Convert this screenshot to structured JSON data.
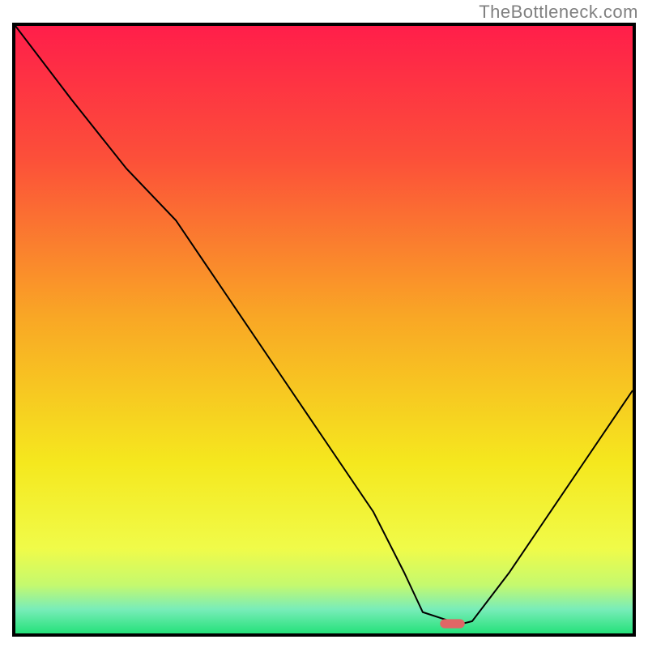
{
  "watermark_text": "TheBottleneck.com",
  "chart_data": {
    "type": "line",
    "title": "",
    "xlabel": "",
    "ylabel": "",
    "xlim": [
      0,
      100
    ],
    "ylim": [
      0,
      100
    ],
    "grid": false,
    "legend": false,
    "background_gradient": {
      "stops": [
        {
          "offset": 0.0,
          "color": "#ff1e4a"
        },
        {
          "offset": 0.22,
          "color": "#fc5039"
        },
        {
          "offset": 0.48,
          "color": "#f9a725"
        },
        {
          "offset": 0.72,
          "color": "#f5e81e"
        },
        {
          "offset": 0.86,
          "color": "#f0fb49"
        },
        {
          "offset": 0.92,
          "color": "#c5f96e"
        },
        {
          "offset": 0.96,
          "color": "#79edb9"
        },
        {
          "offset": 1.0,
          "color": "#25e17a"
        }
      ]
    },
    "curve": {
      "x": [
        0.0,
        9.0,
        18.0,
        26.0,
        34.0,
        42.0,
        50.0,
        58.0,
        63.0,
        66.0,
        72.0,
        74.0,
        80.0,
        86.0,
        92.0,
        100.0
      ],
      "y": [
        100.0,
        88.0,
        76.5,
        68.0,
        56.0,
        44.0,
        32.0,
        20.0,
        10.0,
        3.5,
        1.5,
        2.0,
        10.0,
        19.0,
        28.0,
        40.0
      ]
    },
    "marker": {
      "x": 70.8,
      "y": 1.6,
      "w": 4.0,
      "h": 1.5,
      "color": "#e06666"
    }
  }
}
